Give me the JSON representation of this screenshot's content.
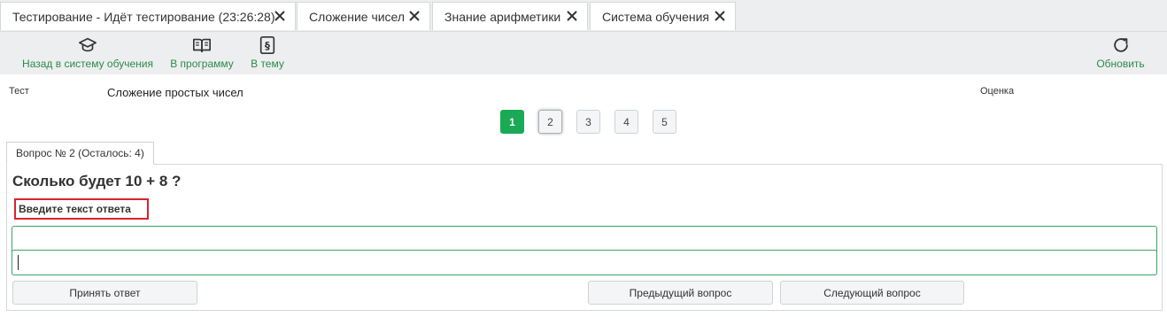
{
  "tabs": [
    {
      "label": "Тестирование - Идёт тестирование (23:26:28)"
    },
    {
      "label": "Сложение чисел"
    },
    {
      "label": "Знание арифметики"
    },
    {
      "label": "Система обучения"
    }
  ],
  "toolbar": {
    "back": "Назад в систему обучения",
    "program": "В программу",
    "topic": "В тему",
    "refresh": "Обновить"
  },
  "info": {
    "test_label": "Тест",
    "test_value": "Сложение простых чисел",
    "grade_label": "Оценка"
  },
  "pagination": [
    "1",
    "2",
    "3",
    "4",
    "5"
  ],
  "question": {
    "tab_label": "Вопрос № 2 (Осталось: 4)",
    "text": "Сколько будет 10 + 8 ?",
    "hint": "Введите текст ответа",
    "answer_value": ""
  },
  "buttons": {
    "accept": "Принять ответ",
    "prev": "Предыдущий вопрос",
    "next": "Следующий вопрос"
  },
  "colors": {
    "accent": "#1aaa55",
    "toolbar_text": "#2d8a4a",
    "hint_border": "#d9232d"
  }
}
